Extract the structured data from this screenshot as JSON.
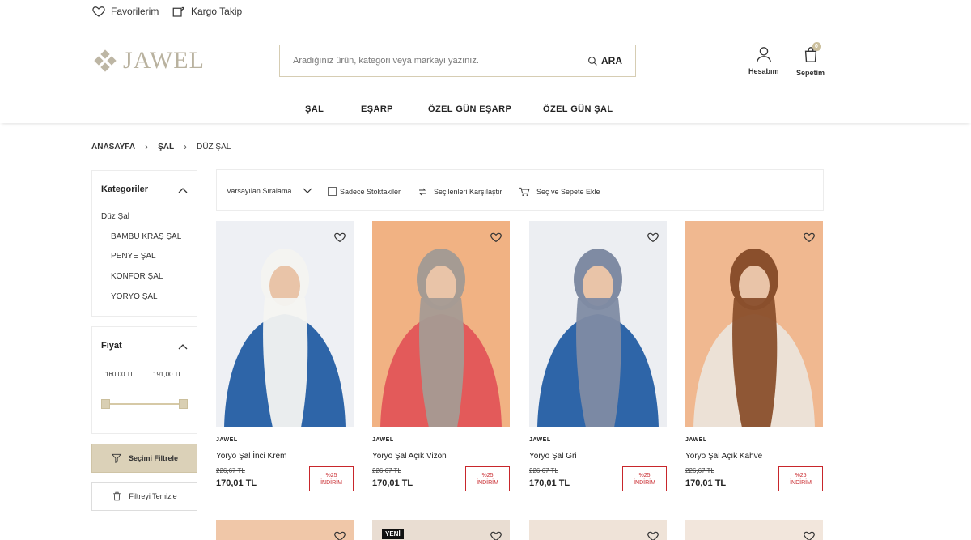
{
  "topbar": {
    "favorites": "Favorilerim",
    "cargo": "Kargo Takip"
  },
  "header": {
    "logo": "JAWEL",
    "search_placeholder": "Aradığınız ürün, kategori veya markayı yazınız.",
    "search_button": "ARA",
    "account": "Hesabım",
    "cart": "Sepetim",
    "cart_count": "0"
  },
  "nav": [
    "ŞAL",
    "EŞARP",
    "ÖZEL GÜN EŞARP",
    "ÖZEL GÜN ŞAL"
  ],
  "breadcrumb": [
    "ANASAYFA",
    "ŞAL",
    "DÜZ ŞAL"
  ],
  "sidebar": {
    "categories_title": "Kategoriler",
    "current_category": "Düz Şal",
    "subcategories": [
      "BAMBU KRAŞ ŞAL",
      "PENYE ŞAL",
      "KONFOR ŞAL",
      "YORYO ŞAL"
    ],
    "price_title": "Fiyat",
    "price_min": "160,00 TL",
    "price_max": "191,00 TL",
    "filter_button": "Seçimi Filtrele",
    "clear_button": "Filtreyi Temizle"
  },
  "toolbar": {
    "sort": "Varsayılan Sıralama",
    "in_stock": "Sadece Stoktakiler",
    "compare": "Seçilenleri Karşılaştır",
    "add_to_cart": "Seç ve Sepete Ekle"
  },
  "products": [
    {
      "brand": "JAWEL",
      "name": "Yoryo Şal İnci Krem",
      "old_price": "226,67 TL",
      "price": "170,01 TL",
      "discount": "%25",
      "discount_label": "İNDİRİM",
      "bg": "#eef0f4",
      "scarf": "#f4f4f1",
      "dress": "#2e65a8"
    },
    {
      "brand": "JAWEL",
      "name": "Yoryo Şal Açık Vizon",
      "old_price": "226,67 TL",
      "price": "170,01 TL",
      "discount": "%25",
      "discount_label": "İNDİRİM",
      "bg": "#f1b283",
      "scarf": "#a59b93",
      "dress": "#e35a5a"
    },
    {
      "brand": "JAWEL",
      "name": "Yoryo Şal Gri",
      "old_price": "226,67 TL",
      "price": "170,01 TL",
      "discount": "%25",
      "discount_label": "İNDİRİM",
      "bg": "#eceef2",
      "scarf": "#7f8ba3",
      "dress": "#2e65a8"
    },
    {
      "brand": "JAWEL",
      "name": "Yoryo Şal Açık Kahve",
      "old_price": "226,67 TL",
      "price": "170,01 TL",
      "discount": "%25",
      "discount_label": "İNDİRİM",
      "bg": "#f0b890",
      "scarf": "#8a4f2c",
      "dress": "#ece1d6"
    }
  ],
  "second_row": {
    "new_badge": "YENİ",
    "bgs": [
      "#f0c7a8",
      "#e9ddd2",
      "#efe3d8",
      "#f2e6dc"
    ]
  }
}
